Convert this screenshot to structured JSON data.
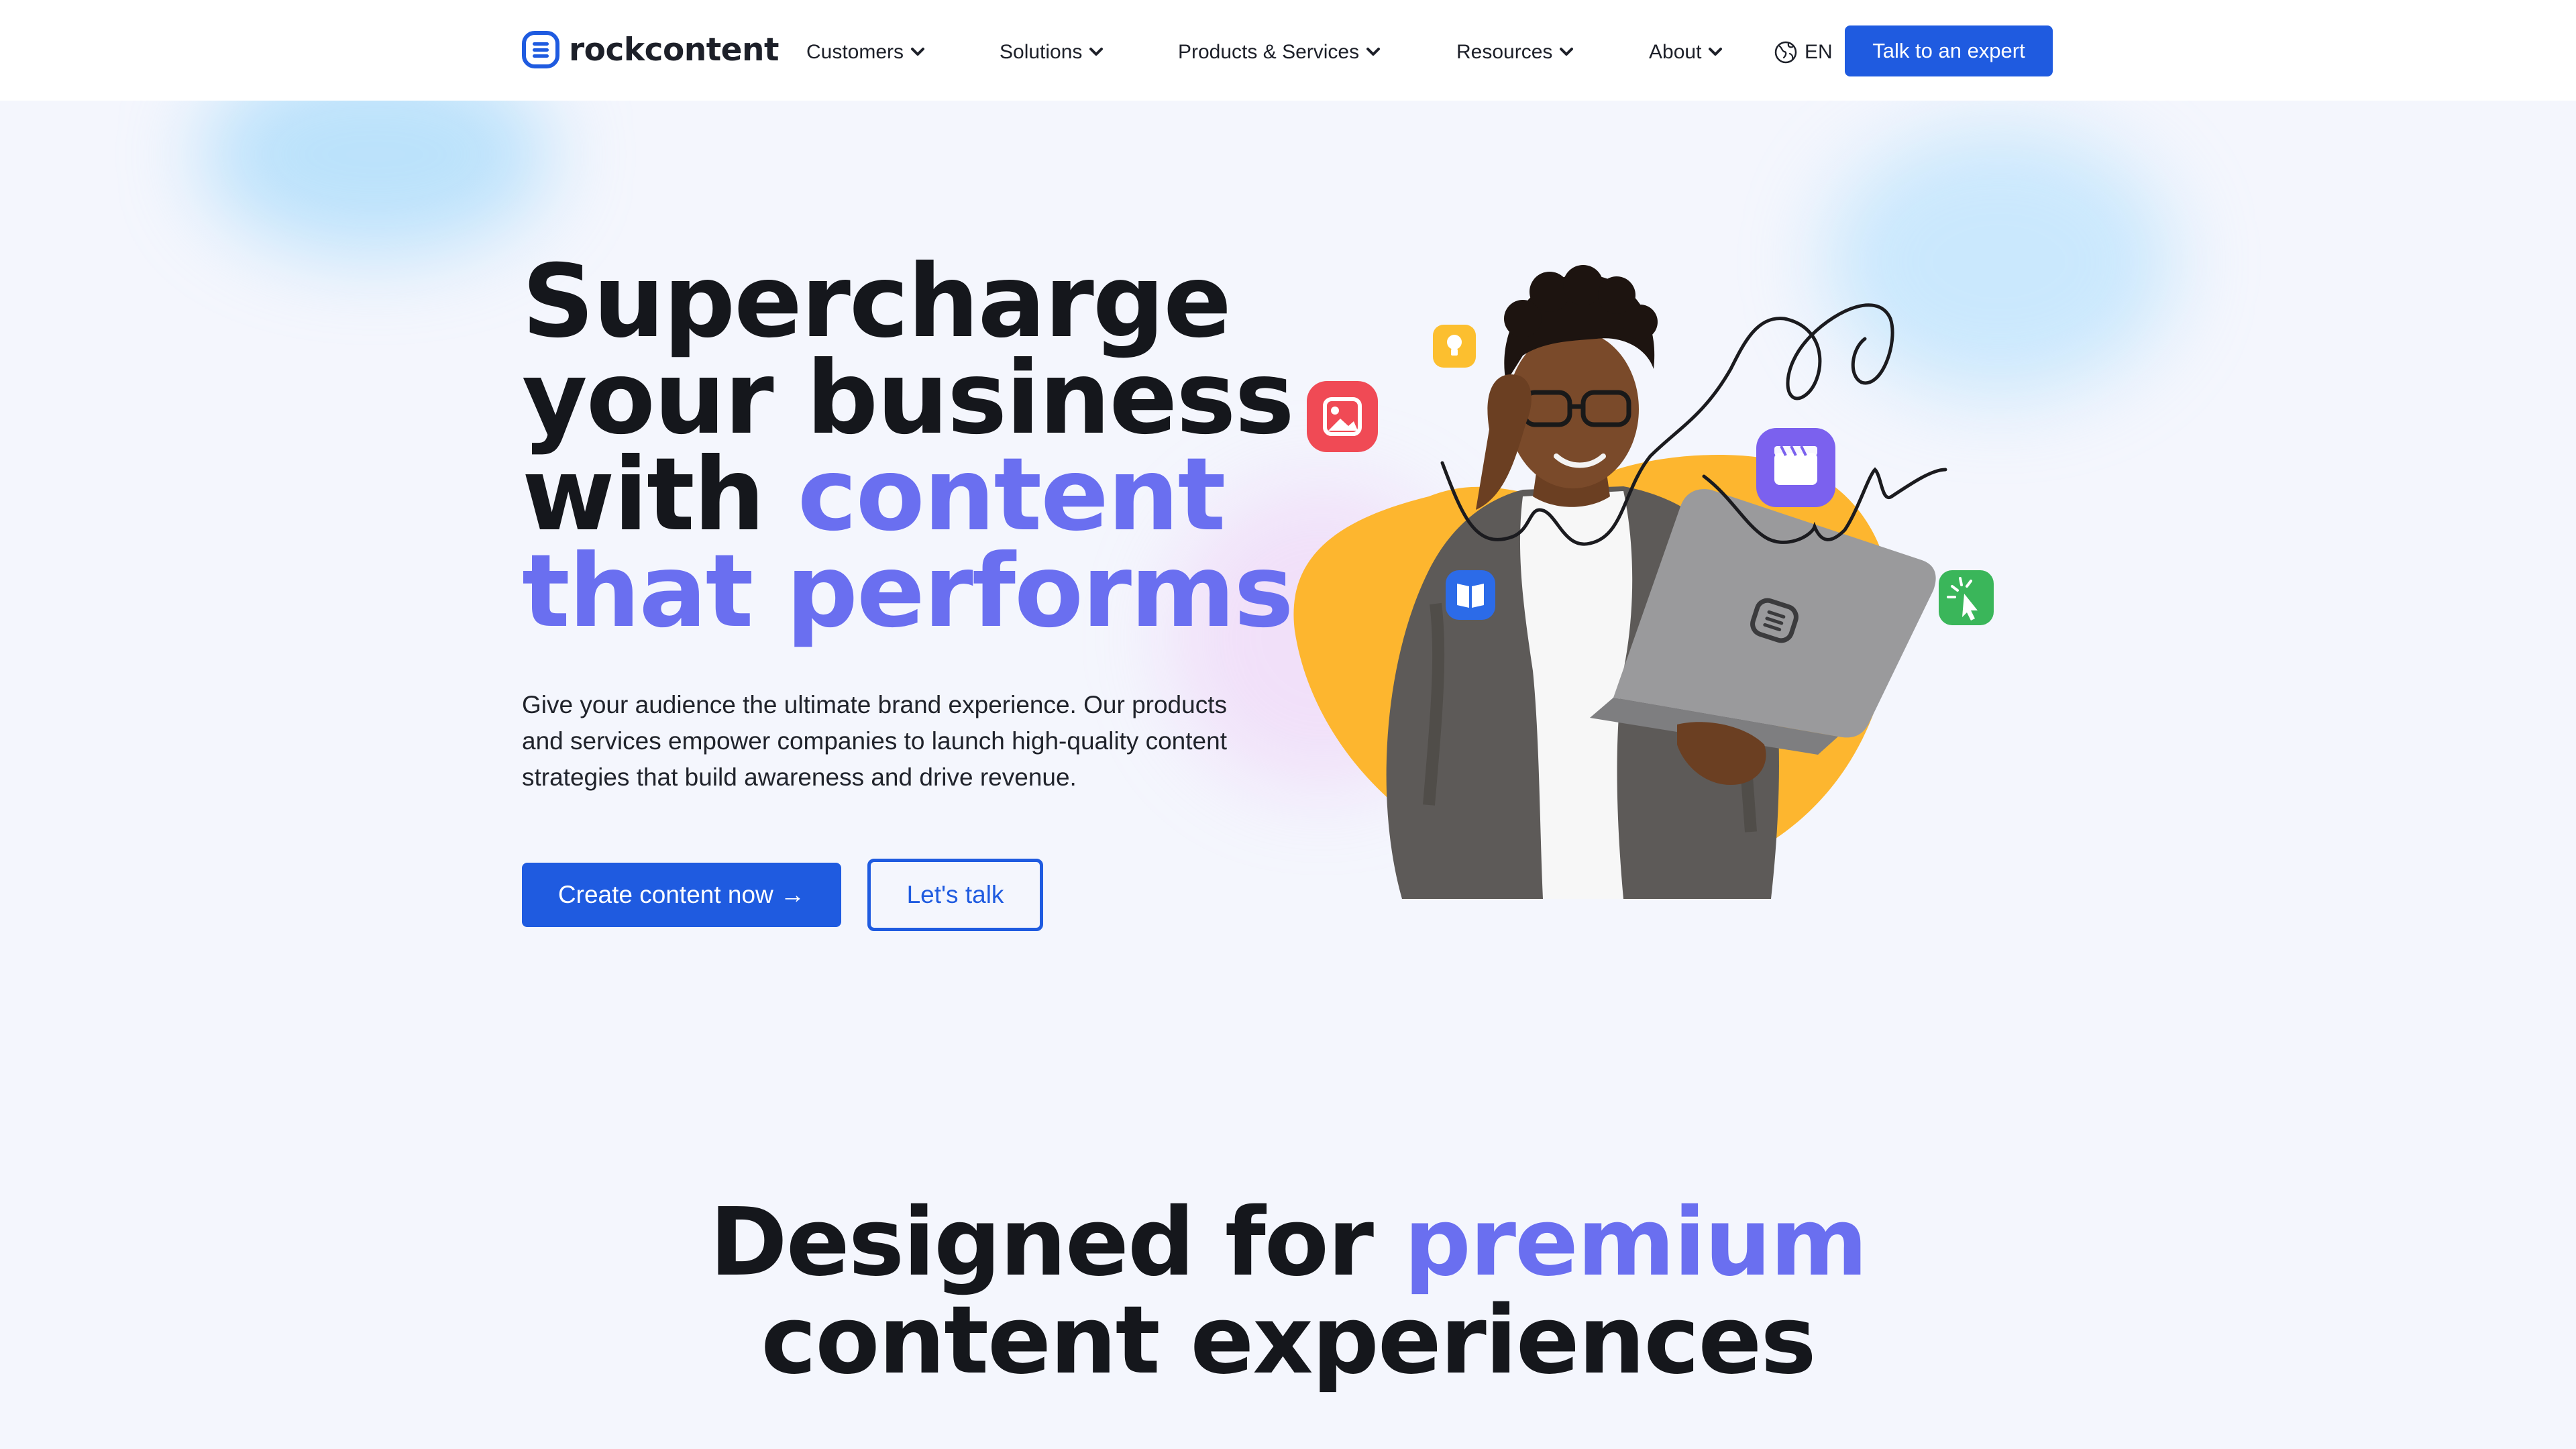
{
  "brand": {
    "name": "rockcontent",
    "primary_color": "#1f5be0",
    "accent_color": "#6a6ff0",
    "logo_icon": "rockcontent-logo-icon"
  },
  "nav": {
    "items": [
      {
        "label": "Customers",
        "icon": "chevron-down-icon"
      },
      {
        "label": "Solutions",
        "icon": "chevron-down-icon"
      },
      {
        "label": "Products & Services",
        "icon": "chevron-down-icon"
      },
      {
        "label": "Resources",
        "icon": "chevron-down-icon"
      },
      {
        "label": "About",
        "icon": "chevron-down-icon"
      }
    ],
    "language": {
      "label": "EN",
      "icon": "globe-icon"
    },
    "cta": "Talk to an expert"
  },
  "hero": {
    "headline": {
      "line1": "Supercharge",
      "line2": "your business",
      "line3_plain": "with ",
      "line3_accent": "content",
      "line4": "that performs"
    },
    "subtitle": "Give your audience the ultimate brand experience. Our products and services empower companies to launch high-quality content strategies that build awareness and drive revenue.",
    "primary_button": "Create content now →",
    "secondary_button": "Let's talk",
    "floating_icons": [
      "lightbulb-icon",
      "image-icon",
      "video-clapper-icon",
      "book-icon",
      "cursor-click-icon"
    ],
    "photo_colors": {
      "blob": "#fdb62f",
      "image_badge": "#f04a55",
      "video_badge": "#7b61ee",
      "book_badge": "#2c6be8",
      "click_badge": "#3ab65a",
      "bulb_badge": "#fcbf2f"
    }
  },
  "section": {
    "title_plain": "Designed for ",
    "title_accent": "premium",
    "title_line2": "content experiences"
  }
}
